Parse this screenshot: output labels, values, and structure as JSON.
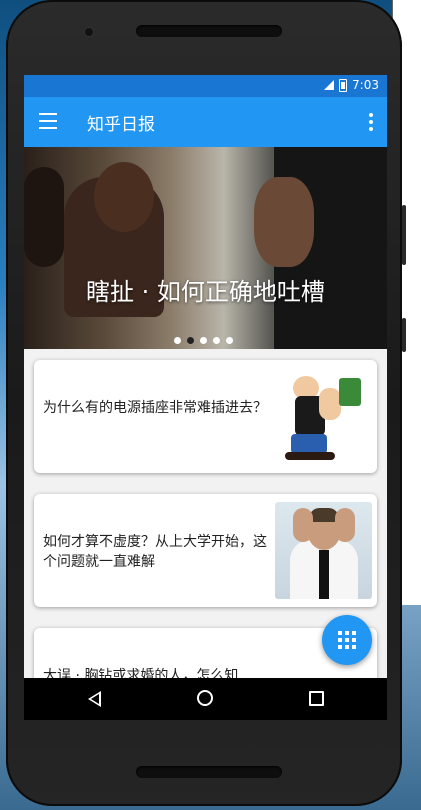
{
  "status_bar": {
    "time": "7:03"
  },
  "app_bar": {
    "title": "知乎日报"
  },
  "banner": {
    "title": "瞎扯 · 如何正确地吐槽",
    "dots": 5,
    "active_dot": 1
  },
  "stories": [
    {
      "title": "为什么有的电源插座非常难插进去？",
      "image": "popeye-image"
    },
    {
      "title": "如何才算不虚度？从上大学开始，这个问题就一直难解",
      "image": "stressed-man-image"
    },
    {
      "title": "大误 · 胸钻或求婚的人，怎么知"
    }
  ],
  "icons": [
    "menu-icon",
    "more-vert-icon",
    "signal-icon",
    "battery-icon",
    "grid-icon",
    "back-icon",
    "home-icon",
    "recents-icon"
  ],
  "colors": {
    "primary": "#2196f3",
    "status": "#1976d2"
  }
}
